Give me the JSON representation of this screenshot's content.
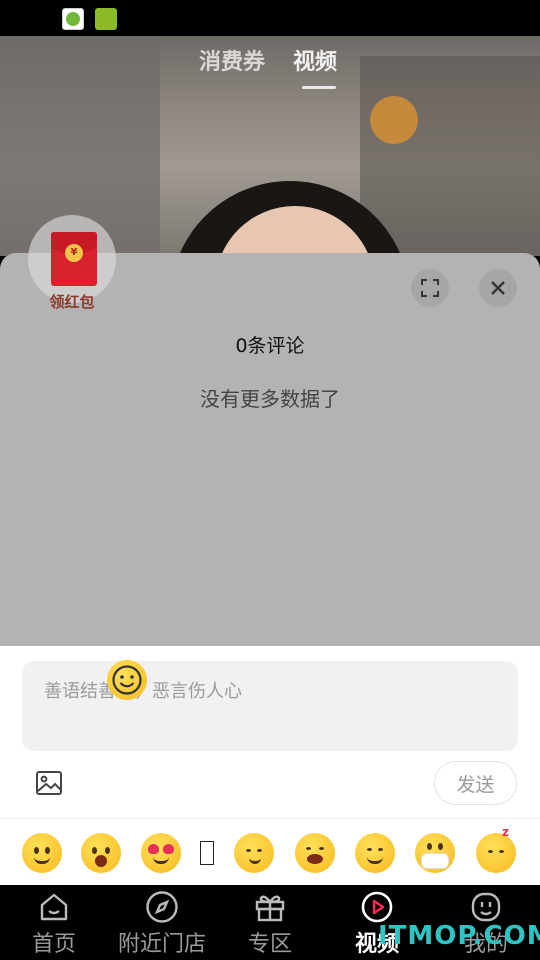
{
  "header": {
    "tabs": [
      {
        "label": "消费券"
      },
      {
        "label": "视频"
      }
    ]
  },
  "red_packet": {
    "label": "领红包",
    "coin_symbol": "¥"
  },
  "comments": {
    "count_label": "0条评论",
    "empty_message": "没有更多数据了"
  },
  "composer": {
    "placeholder": "善语结善缘，恶言伤人心",
    "send_label": "发送"
  },
  "emoji_bar": {
    "items": [
      "smile-emoji",
      "surprised-emoji",
      "heart-eyes-emoji",
      "missing-glyph",
      "smirk-emoji",
      "laughing-tears-emoji",
      "blush-emoji",
      "mask-emoji",
      "sleepy-emoji"
    ]
  },
  "bottom_nav": {
    "items": [
      {
        "label": "首页",
        "icon": "home-icon"
      },
      {
        "label": "附近门店",
        "icon": "compass-icon"
      },
      {
        "label": "专区",
        "icon": "gift-icon"
      },
      {
        "label": "视频",
        "icon": "video-play-icon",
        "active": true
      },
      {
        "label": "我的",
        "icon": "profile-icon"
      }
    ]
  },
  "watermark": {
    "text": "ITMOP.COM"
  },
  "colors": {
    "accent_red": "#d8212c",
    "panel_dim": "#b3b3b3",
    "watermark": "#2ec4c4",
    "nav_active": "#ff2d55"
  }
}
